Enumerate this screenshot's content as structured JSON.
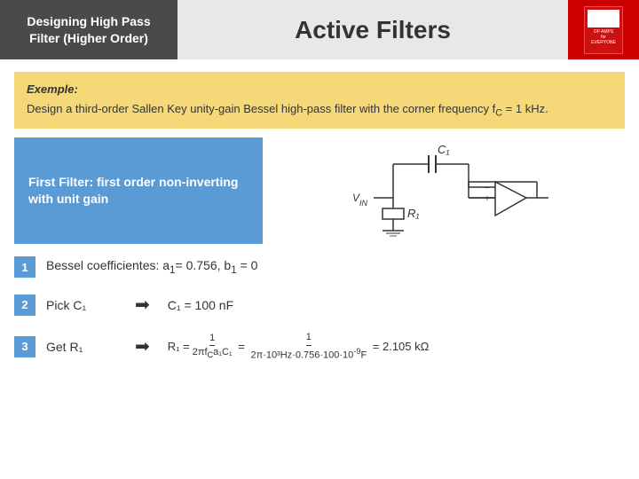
{
  "header": {
    "left_title": "Designing High Pass Filter (Higher Order)",
    "center_title": "Active Filters"
  },
  "example": {
    "label": "Exemple:",
    "text": "Design a third-order Sallen Key unity-gain Bessel high-pass filter with the corner frequency f",
    "subscript": "C",
    "text2": " = 1 kHz."
  },
  "first_filter": {
    "label": "First Filter: first order non-inverting with unit gain"
  },
  "circuit": {
    "c1_label": "C₁",
    "r1_label": "R₁",
    "vin_label": "Vᴵᴺ"
  },
  "steps": [
    {
      "number": "1",
      "text": "Bessel coefficientes: a",
      "sub": "1",
      "text2": "= 0.756, b",
      "sub2": "1",
      "text3": " = 0"
    },
    {
      "number": "2",
      "text": "Pick C₁",
      "arrow": "➡",
      "result": "C₁ = 100 nF"
    },
    {
      "number": "3",
      "text": "Get R₁",
      "arrow": "➡",
      "formula_left": "R₁ =",
      "frac1_num": "1",
      "frac1_den": "2πfᴶa₁C₁",
      "equals": "=",
      "frac2_num": "1",
      "frac2_den": "2π·10³Hz·0.756·100·10",
      "frac2_den_sup": "-9",
      "frac2_den_end": "F",
      "result": "= 2.105 kΩ"
    }
  ]
}
